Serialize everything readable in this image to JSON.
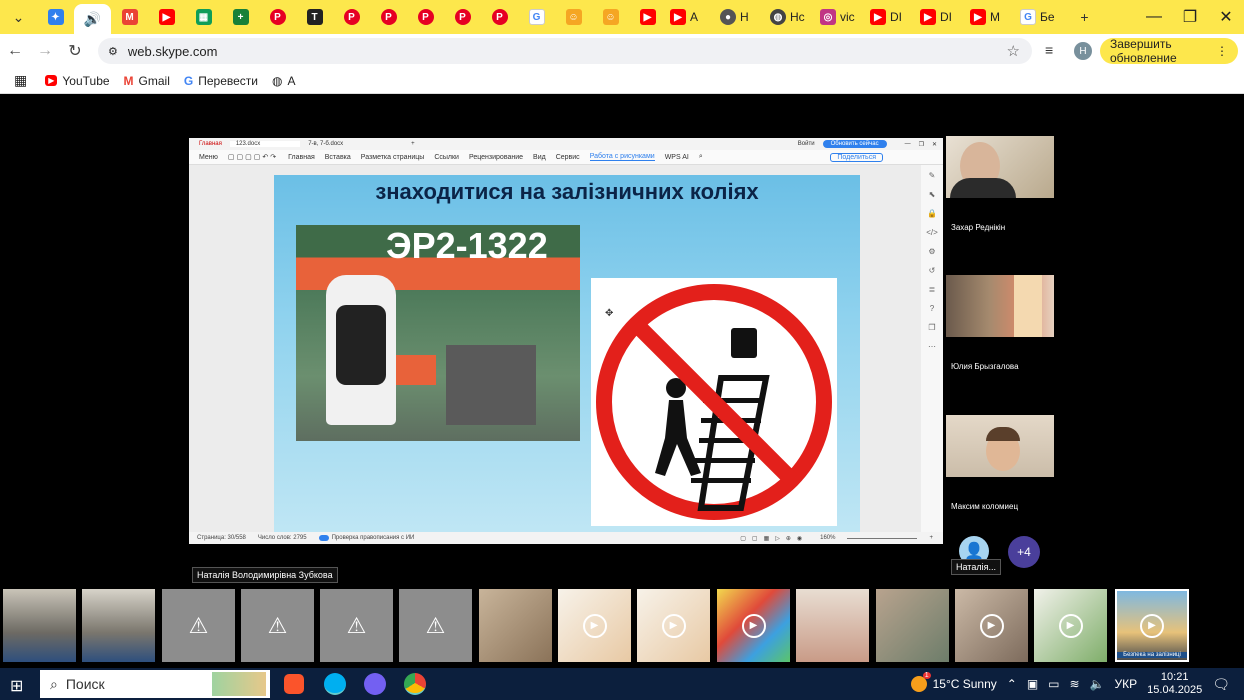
{
  "browser": {
    "tabs": [
      {
        "icon": "chevron-down-icon",
        "label": ""
      },
      {
        "icon": "bird-icon",
        "label": ""
      },
      {
        "icon": "speaker-icon",
        "label": ""
      },
      {
        "icon": "gmail-icon",
        "label": ""
      },
      {
        "icon": "youtube-icon",
        "label": ""
      },
      {
        "icon": "sheets-icon",
        "label": ""
      },
      {
        "icon": "plus-icon",
        "label": ""
      },
      {
        "icon": "pinterest-icon",
        "label": ""
      },
      {
        "icon": "text-icon",
        "label": ""
      },
      {
        "icon": "pinterest-icon",
        "label": ""
      },
      {
        "icon": "pinterest-icon",
        "label": ""
      },
      {
        "icon": "pinterest-icon",
        "label": ""
      },
      {
        "icon": "pinterest-icon",
        "label": ""
      },
      {
        "icon": "pinterest-icon",
        "label": ""
      },
      {
        "icon": "google-icon",
        "label": ""
      },
      {
        "icon": "person-icon",
        "label": ""
      },
      {
        "icon": "person-icon",
        "label": ""
      },
      {
        "icon": "youtube-icon",
        "label": ""
      }
    ],
    "wide_tabs": [
      {
        "icon": "youtube-icon",
        "label": "А"
      },
      {
        "icon": "record-icon",
        "label": "Н"
      },
      {
        "icon": "globe-icon",
        "label": "Нс"
      },
      {
        "icon": "instagram-icon",
        "label": "vic"
      },
      {
        "icon": "youtube-icon",
        "label": "DI"
      },
      {
        "icon": "youtube-icon",
        "label": "DI"
      },
      {
        "icon": "youtube-icon",
        "label": "M"
      },
      {
        "icon": "google-icon",
        "label": "Бе"
      }
    ],
    "url": "web.skype.com",
    "update_label": "Завершить обновление",
    "profile_initial": "Н",
    "bookmarks": [
      {
        "icon": "youtube-icon",
        "label": "YouTube"
      },
      {
        "icon": "gmail-icon",
        "label": "Gmail"
      },
      {
        "icon": "translate-icon",
        "label": "Перевести"
      },
      {
        "icon": "globe-icon",
        "label": "А"
      }
    ]
  },
  "wps": {
    "tabs": [
      "Главная",
      "123.docx",
      "7-в, 7-б.docx"
    ],
    "signin": "Войти",
    "update_btn": "Обновить сейчас",
    "menu": [
      "Меню",
      "Главная",
      "Вставка",
      "Разметка страницы",
      "Ссылки",
      "Рецензирование",
      "Вид",
      "Сервис",
      "Работа с рисунками",
      "WPS AI"
    ],
    "share": "Поделиться",
    "slide_title": "знаходитися на залізничних коліях",
    "photo_number": "ЭР2-1322",
    "status": {
      "page": "Страница: 30/558",
      "words": "Число слов: 2795",
      "spell": "Проверка правописания с ИИ",
      "zoom": "160%"
    }
  },
  "participants": [
    {
      "name": "Захар Реднікін"
    },
    {
      "name": "Юлия Брызгалова"
    },
    {
      "name": "Максим коломиец"
    }
  ],
  "overflow_count": "+4",
  "avatar_label": "Наталія...",
  "speaker_tooltip": "Наталія Володимирівна Зубкова",
  "thumb_caption": "Безпека на залізниці",
  "taskbar": {
    "search": "Поиск",
    "weather": "15°C Sunny",
    "lang": "УКР",
    "time": "10:21",
    "date": "15.04.2025",
    "weather_badge": "1"
  }
}
